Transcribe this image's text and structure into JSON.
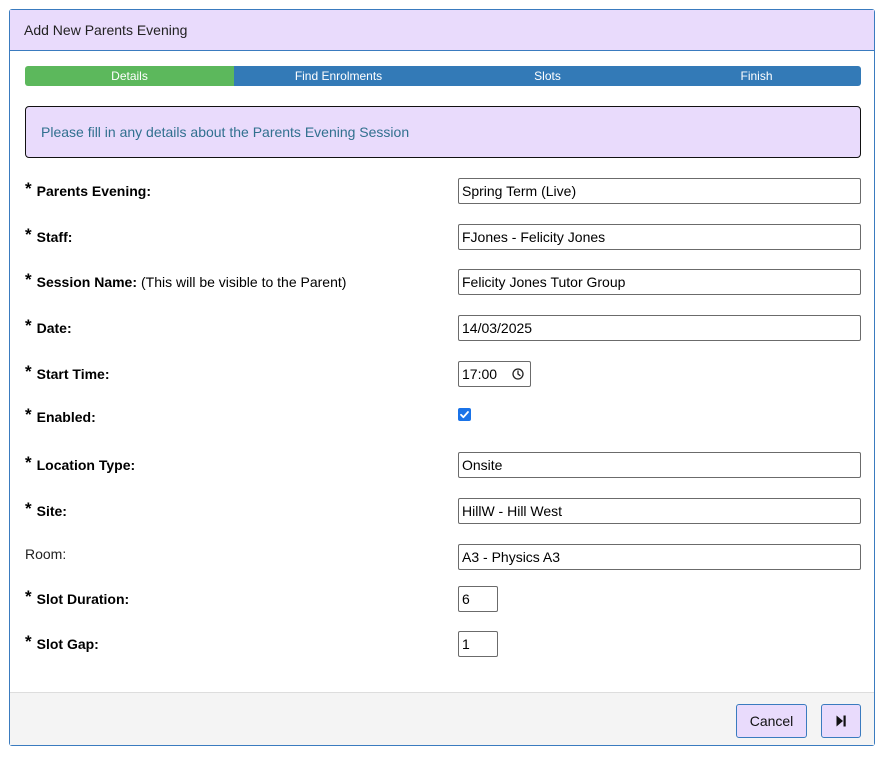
{
  "dialog": {
    "title": "Add New Parents Evening"
  },
  "steps": [
    {
      "label": "Details",
      "active": true
    },
    {
      "label": "Find Enrolments",
      "active": false
    },
    {
      "label": "Slots",
      "active": false
    },
    {
      "label": "Finish",
      "active": false
    }
  ],
  "info": {
    "message": "Please fill in any details about the Parents Evening Session"
  },
  "form": {
    "parents_evening": {
      "label": "Parents Evening:",
      "value": "Spring Term (Live)"
    },
    "staff": {
      "label": "Staff:",
      "value": "FJones - Felicity Jones"
    },
    "session_name": {
      "label": "Session Name:",
      "note": "(This will be visible to the Parent)",
      "value": "Felicity Jones Tutor Group"
    },
    "date": {
      "label": "Date:",
      "value": "14/03/2025"
    },
    "start_time": {
      "label": "Start Time:",
      "value": "17:00"
    },
    "enabled": {
      "label": "Enabled:",
      "checked": true
    },
    "location_type": {
      "label": "Location Type:",
      "value": "Onsite"
    },
    "site": {
      "label": "Site:",
      "value": "HillW - Hill West"
    },
    "room": {
      "label": "Room:",
      "value": "A3 - Physics A3"
    },
    "slot_duration": {
      "label": "Slot Duration:",
      "value": "6"
    },
    "slot_gap": {
      "label": "Slot Gap:",
      "value": "1"
    },
    "required_marker": "*"
  },
  "footer": {
    "cancel_label": "Cancel",
    "next_icon": "skip-next-icon"
  },
  "colors": {
    "header_bg": "#e9dbfc",
    "step_active": "#5cb85c",
    "step_inactive": "#337ab7",
    "border": "#3a7bbf",
    "info_text": "#31708f",
    "checkbox": "#1a73e8"
  }
}
